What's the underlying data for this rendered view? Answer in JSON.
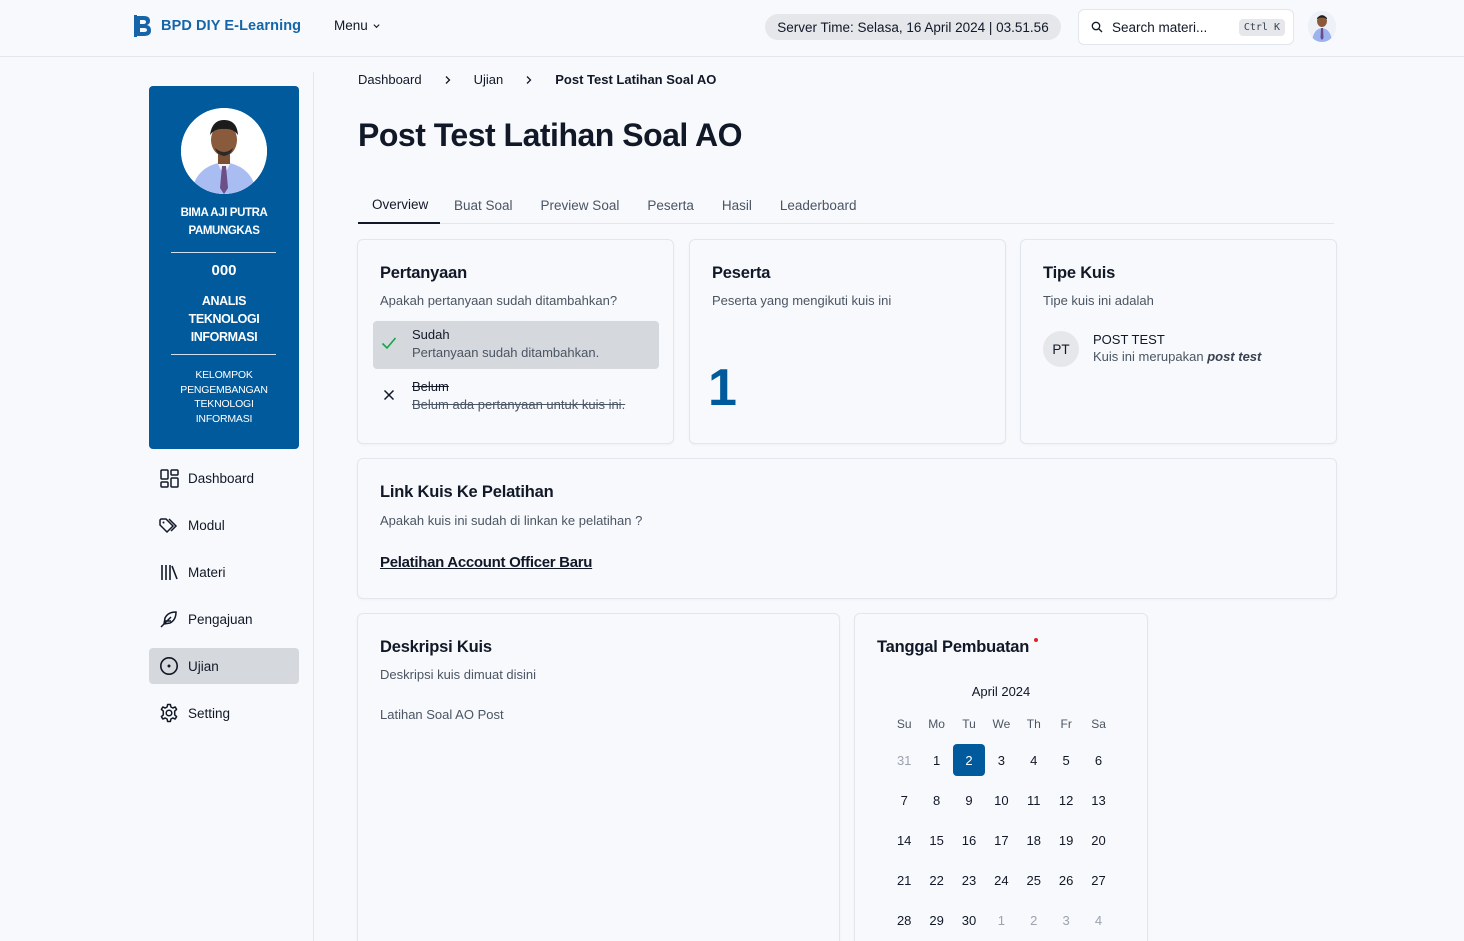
{
  "app": {
    "name": "BPD DIY E-Learning",
    "menu_label": "Menu"
  },
  "header": {
    "server_time": "Server Time: Selasa, 16 April 2024 | 03.51.56",
    "search_placeholder": "Search materi...",
    "search_shortcut": "Ctrl K"
  },
  "profile": {
    "name": "BIMA AJI PUTRA PAMUNGKAS",
    "nip": "000",
    "job": "ANALIS TEKNOLOGI INFORMASI",
    "group": "KELOMPOK PENGEMBANGAN TEKNOLOGI INFORMASI"
  },
  "sidebar": {
    "items": [
      {
        "label": "Dashboard",
        "icon": "dashboard-icon"
      },
      {
        "label": "Modul",
        "icon": "tags-icon"
      },
      {
        "label": "Materi",
        "icon": "library-icon"
      },
      {
        "label": "Pengajuan",
        "icon": "feather-icon"
      },
      {
        "label": "Ujian",
        "icon": "timer-icon",
        "active": true
      },
      {
        "label": "Setting",
        "icon": "gear-icon"
      }
    ]
  },
  "breadcrumb": {
    "items": [
      "Dashboard",
      "Ujian"
    ],
    "current": "Post Test Latihan Soal AO"
  },
  "page_title": "Post Test Latihan Soal AO",
  "tabs": [
    "Overview",
    "Buat Soal",
    "Preview Soal",
    "Peserta",
    "Hasil",
    "Leaderboard"
  ],
  "active_tab": "Overview",
  "cards": {
    "pertanyaan": {
      "title": "Pertanyaan",
      "subtitle": "Apakah pertanyaan sudah ditambahkan?",
      "options": [
        {
          "label": "Sudah",
          "desc": "Pertanyaan sudah ditambahkan.",
          "checked": true
        },
        {
          "label": "Belum",
          "desc": "Belum ada pertanyaan untuk kuis ini.",
          "checked": false
        }
      ]
    },
    "peserta": {
      "title": "Peserta",
      "subtitle": "Peserta yang mengikuti kuis ini",
      "count": "1"
    },
    "tipe": {
      "title": "Tipe Kuis",
      "subtitle": "Tipe kuis ini adalah",
      "badge": "PT",
      "type_title": "POST TEST",
      "type_desc_prefix": "Kuis ini merupakan",
      "type_desc_em": "post test"
    },
    "link": {
      "title": "Link Kuis Ke Pelatihan",
      "subtitle": "Apakah kuis ini sudah di linkan ke pelatihan ?",
      "training": "Pelatihan Account Officer Baru"
    },
    "deskripsi": {
      "title": "Deskripsi Kuis",
      "subtitle": "Deskripsi kuis dimuat disini",
      "body": "Latihan Soal AO Post"
    },
    "tanggal": {
      "title": "Tanggal Pembuatan",
      "month": "April 2024",
      "weekdays": [
        "Su",
        "Mo",
        "Tu",
        "We",
        "Th",
        "Fr",
        "Sa"
      ],
      "days": [
        {
          "d": "31",
          "o": true
        },
        {
          "d": "1"
        },
        {
          "d": "2",
          "s": true
        },
        {
          "d": "3"
        },
        {
          "d": "4"
        },
        {
          "d": "5"
        },
        {
          "d": "6"
        },
        {
          "d": "7"
        },
        {
          "d": "8"
        },
        {
          "d": "9"
        },
        {
          "d": "10"
        },
        {
          "d": "11"
        },
        {
          "d": "12"
        },
        {
          "d": "13"
        },
        {
          "d": "14"
        },
        {
          "d": "15"
        },
        {
          "d": "16"
        },
        {
          "d": "17"
        },
        {
          "d": "18"
        },
        {
          "d": "19"
        },
        {
          "d": "20"
        },
        {
          "d": "21"
        },
        {
          "d": "22"
        },
        {
          "d": "23"
        },
        {
          "d": "24"
        },
        {
          "d": "25"
        },
        {
          "d": "26"
        },
        {
          "d": "27"
        },
        {
          "d": "28"
        },
        {
          "d": "29"
        },
        {
          "d": "30"
        },
        {
          "d": "1",
          "o": true
        },
        {
          "d": "2",
          "o": true
        },
        {
          "d": "3",
          "o": true
        },
        {
          "d": "4",
          "o": true
        }
      ],
      "accent": "#015a9c"
    }
  }
}
